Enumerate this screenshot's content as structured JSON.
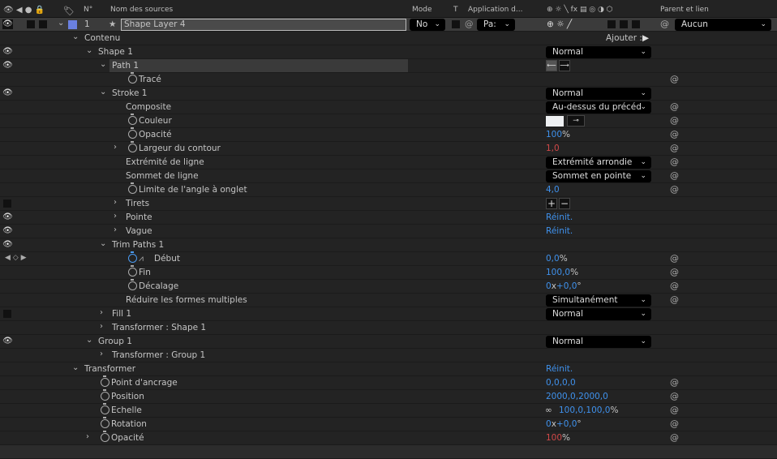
{
  "header": {
    "source_name": "Nom des sources",
    "number": "N°",
    "mode": "Mode",
    "track": "T",
    "application": "Application d...",
    "parent": "Parent et lien"
  },
  "layer": {
    "number": "1",
    "name": "Shape Layer 4",
    "mode": "No",
    "application": "Pa:",
    "parent": "Aucun",
    "color": "#6a80e0"
  },
  "add_label": "Ajouter :",
  "colors": {
    "blue": "#3f91ec",
    "red": "#d04848",
    "bg": "#232323"
  },
  "rows": [
    {
      "label": "Contenu",
      "level": 0,
      "twirl": "open"
    },
    {
      "label": "Shape 1",
      "level": 1,
      "twirl": "open",
      "eye": true,
      "dropdown": "Normal"
    },
    {
      "label": "Path 1",
      "level": 2,
      "twirl": "open",
      "eye": true,
      "selected": true,
      "pathbtns": true
    },
    {
      "label": "Tracé",
      "level": 3,
      "stopwatch": true,
      "link": true
    },
    {
      "label": "Stroke 1",
      "level": 2,
      "twirl": "open",
      "eye": true,
      "dropdown": "Normal"
    },
    {
      "label": "Composite",
      "level": 3,
      "dropdown": "Au-dessus du précéd",
      "link": true
    },
    {
      "label": "Couleur",
      "level": 3,
      "stopwatch": true,
      "swatch": "#eef0f2",
      "link": true
    },
    {
      "label": "Opacité",
      "level": 3,
      "stopwatch": true,
      "value": [
        {
          "t": "100",
          "c": "blue"
        },
        {
          "t": "%"
        }
      ],
      "link": true
    },
    {
      "label": "Largeur du contour",
      "level": 3,
      "twirl": "closed",
      "stopwatch": true,
      "value": [
        {
          "t": "1,0",
          "c": "red"
        }
      ],
      "link": true
    },
    {
      "label": "Extrémité de ligne",
      "level": 3,
      "dropdown": "Extrémité arrondie",
      "link": true
    },
    {
      "label": "Sommet de ligne",
      "level": 3,
      "dropdown": "Sommet en pointe",
      "link": true
    },
    {
      "label": "Limite de l'angle à onglet",
      "level": 3,
      "stopwatch": true,
      "value": [
        {
          "t": "4,0",
          "c": "blue"
        }
      ],
      "link": true
    },
    {
      "label": "Tirets",
      "level": 3,
      "twirl": "closed",
      "square": true,
      "plusminus": true
    },
    {
      "label": "Pointe",
      "level": 3,
      "twirl": "closed",
      "eye": true,
      "value": [
        {
          "t": "Réinit.",
          "c": "blue"
        }
      ]
    },
    {
      "label": "Vague",
      "level": 3,
      "twirl": "closed",
      "eye": true,
      "value": [
        {
          "t": "Réinit.",
          "c": "blue"
        }
      ]
    },
    {
      "label": "Trim Paths 1",
      "level": 2,
      "twirl": "open",
      "eye": true
    },
    {
      "label": "Début",
      "level": 3,
      "stopwatch": "on",
      "graph": true,
      "keynav": true,
      "value": [
        {
          "t": "0,0",
          "c": "blue"
        },
        {
          "t": "%"
        }
      ],
      "link": true
    },
    {
      "label": "Fin",
      "level": 3,
      "stopwatch": true,
      "value": [
        {
          "t": "100,0",
          "c": "blue"
        },
        {
          "t": "%"
        }
      ],
      "link": true
    },
    {
      "label": "Décalage",
      "level": 3,
      "stopwatch": true,
      "value": [
        {
          "t": "0",
          "c": "blue"
        },
        {
          "t": "x"
        },
        {
          "t": "+0,0",
          "c": "blue"
        },
        {
          "t": "°"
        }
      ],
      "link": true
    },
    {
      "label": "Réduire les formes multiples",
      "level": 3,
      "dropdown": "Simultanément",
      "link": true
    },
    {
      "label": "Fill 1",
      "level": 2,
      "twirl": "closed",
      "square": true,
      "dropdown": "Normal"
    },
    {
      "label": "Transformer : Shape 1",
      "level": 2,
      "twirl": "closed"
    },
    {
      "label": "Group 1",
      "level": 1,
      "twirl": "open",
      "eye": true,
      "dropdown": "Normal"
    },
    {
      "label": "Transformer : Group 1",
      "level": 2,
      "twirl": "closed"
    },
    {
      "label": "Transformer",
      "level": 0,
      "twirl": "open",
      "value": [
        {
          "t": "Réinit.",
          "c": "blue"
        }
      ]
    },
    {
      "label": "Point d'ancrage",
      "level": 1,
      "stopwatch": true,
      "value": [
        {
          "t": "0,0,0,0",
          "c": "blue"
        }
      ],
      "link": true
    },
    {
      "label": "Position",
      "level": 1,
      "stopwatch": true,
      "value": [
        {
          "t": "2000,0,2000,0",
          "c": "blue"
        }
      ],
      "link": true
    },
    {
      "label": "Echelle",
      "level": 1,
      "stopwatch": true,
      "chain": true,
      "value": [
        {
          "t": "100,0,100,0",
          "c": "blue"
        },
        {
          "t": "%"
        }
      ],
      "link": true
    },
    {
      "label": "Rotation",
      "level": 1,
      "stopwatch": true,
      "value": [
        {
          "t": "0",
          "c": "blue"
        },
        {
          "t": "x"
        },
        {
          "t": "+0,0",
          "c": "blue"
        },
        {
          "t": "°"
        }
      ],
      "link": true
    },
    {
      "label": "Opacité",
      "level": 1,
      "twirl": "closed",
      "stopwatch": true,
      "value": [
        {
          "t": "100",
          "c": "red"
        },
        {
          "t": "%"
        }
      ],
      "link": true
    }
  ]
}
